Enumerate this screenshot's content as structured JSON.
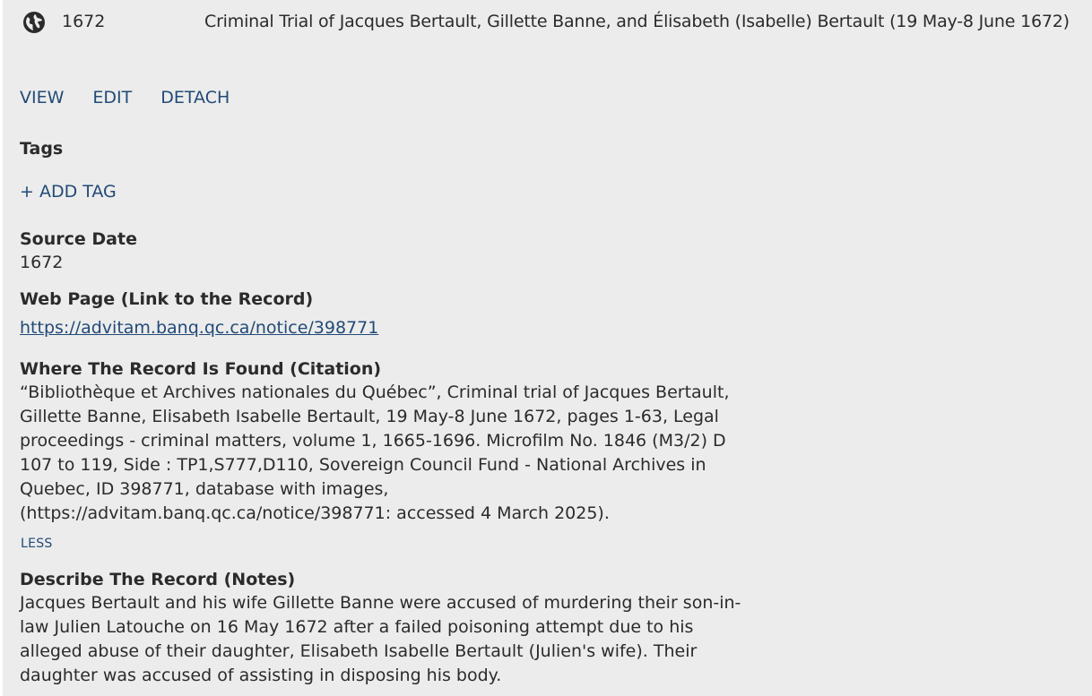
{
  "header": {
    "icon": "globe-icon",
    "date": "1672",
    "title": "Criminal Trial of Jacques Bertault, Gillette Banne, and Élisabeth (Isabelle) Bertault (19 May-8 June 1672)"
  },
  "actions": {
    "view": "VIEW",
    "edit": "EDIT",
    "detach": "DETACH"
  },
  "tags": {
    "label": "Tags",
    "add_tag": "+ ADD TAG"
  },
  "source_date": {
    "label": "Source Date",
    "value": "1672"
  },
  "web_page": {
    "label": "Web Page (Link to the Record)",
    "url": "https://advitam.banq.qc.ca/notice/398771"
  },
  "citation": {
    "label": "Where The Record Is Found (Citation)",
    "lines": [
      "“Bibliothèque et Archives nationales du Québec”, Criminal trial of Jacques Bertault,",
      "Gillette Banne, Elisabeth Isabelle Bertault, 19 May-8 June 1672, pages 1-63, Legal",
      "proceedings - criminal matters, volume 1, 1665-1696. Microfilm No. 1846 (M3/2) D",
      "107 to 119, Side : TP1,S777,D110, Sovereign Council Fund -  National Archives in",
      "Quebec, ID 398771, database with images,",
      "(https://advitam.banq.qc.ca/notice/398771: accessed 4 March 2025)."
    ],
    "less": "LESS"
  },
  "notes": {
    "label": "Describe The Record (Notes)",
    "lines": [
      "Jacques Bertault and his wife Gillette Banne were accused of murdering their  son-in-",
      "law Julien Latouche on 16 May 1672 after a failed poisoning attempt due to his",
      "alleged abuse of their daughter, Elisabeth Isabelle Bertault (Julien's wife). Their",
      "daughter was accused of assisting in disposing his body."
    ]
  },
  "colors": {
    "panel_bg": "#ebeceb",
    "link": "#234a78",
    "text": "#2b2b2b"
  }
}
